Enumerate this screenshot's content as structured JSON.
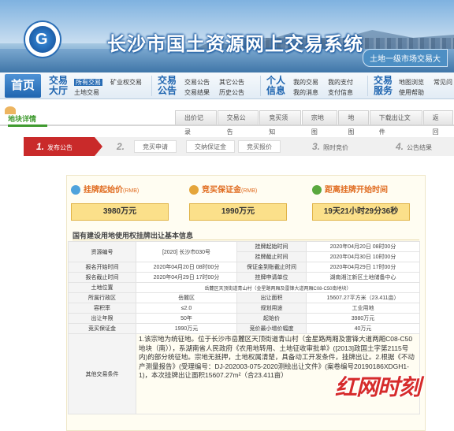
{
  "header": {
    "title": "长沙市国土资源网上交易系统",
    "tag": "土地一级市场交易大"
  },
  "nav": {
    "home": "首页",
    "groups": [
      {
        "big": "交易大厅",
        "col1": [
          "所有交易",
          "土地交易"
        ],
        "col2": [
          "矿业权交易"
        ]
      },
      {
        "big": "交易公告",
        "col1": [
          "交易公告",
          "交易结果"
        ],
        "col2": [
          "其它公告",
          "历史公告"
        ]
      },
      {
        "big": "个人信息",
        "col1": [
          "我的交易",
          "我的消息"
        ],
        "col2": [
          "我的支付",
          "支付信息"
        ]
      },
      {
        "big": "交易服务",
        "col1": [
          "地图浏览",
          "使用帮助"
        ],
        "col2": [
          "常见问"
        ]
      }
    ]
  },
  "land_tag": "地块详情",
  "tabs": [
    "出价记录",
    "交易公告",
    "竞买须知",
    "宗地图",
    "地图",
    "下载出让文件",
    "返回"
  ],
  "steps": {
    "s1": {
      "num": "1.",
      "label": "发布公告"
    },
    "s2": {
      "num": "2."
    },
    "sub": [
      "竞买申请",
      "交纳保证金",
      "竞买报价"
    ],
    "s3": {
      "num": "3.",
      "label": "限时竞价"
    },
    "s4": {
      "num": "4.",
      "label": "公告结果"
    }
  },
  "metrics": [
    {
      "title": "挂牌起始价",
      "unit": "(RMB)",
      "value": "3980万元"
    },
    {
      "title": "竞买保证金",
      "unit": "(RMB)",
      "value": "1990万元"
    },
    {
      "title": "距离挂牌开始时间",
      "unit": "",
      "value": "19天21小时29分36秒"
    }
  ],
  "table_title": "国有建设用地使用权挂牌出让基本信息",
  "table": {
    "r1": [
      "资源编号",
      "[2020] 长沙市030号",
      "挂牌起始时间",
      "2020年04月20日 08时00分"
    ],
    "r2": [
      "挂牌截止时间",
      "2020年04月30日 10时00分"
    ],
    "r3": [
      "报名开始时间",
      "2020年04月20日 08时00分",
      "保证金到账截止时间",
      "2020年04月29日 17时00分"
    ],
    "r4": [
      "报名截止时间",
      "2020年04月29日 17时00分",
      "挂牌申请单位",
      "湖南湘江新区土地储备中心"
    ],
    "r5": [
      "土地位置",
      "岳麓区天顶街道青山村（金星路两厢及雷锋大道两厢C08-C50南地块）"
    ],
    "r6": [
      "所属行政区",
      "岳麓区",
      "出让面积",
      "15607.27平方米（23.411亩）"
    ],
    "r7": [
      "容积率",
      "≤2.0",
      "规划用途",
      "工业用地"
    ],
    "r8": [
      "出让年限",
      "50年",
      "起始价",
      "3980万元"
    ],
    "r9": [
      "竞买保证金",
      "1990万元",
      "竞价最小增价幅度",
      "40万元"
    ],
    "r10": [
      "其他交易条件",
      "1.该宗地为统征地。位于长沙市岳麓区天顶街道青山村（金星路两厢及雷锋大道两厢C08-C50地块（南）），系湖南省人民政府《农用地转用、土地征收审批单》([2013]政国土字第2115号内)的部分统征地。宗地无抵押，土地权属清楚，具备动工开发条件，挂牌出让。2.根据《不动产测量报告》(受理编号：DJ-202003-075-2020测绘出让文件》(案卷编号20190186XDGH1-1)，本次挂牌出让面积15607.27m²（合23.411亩）"
    ]
  },
  "watermark": "红网时刻"
}
